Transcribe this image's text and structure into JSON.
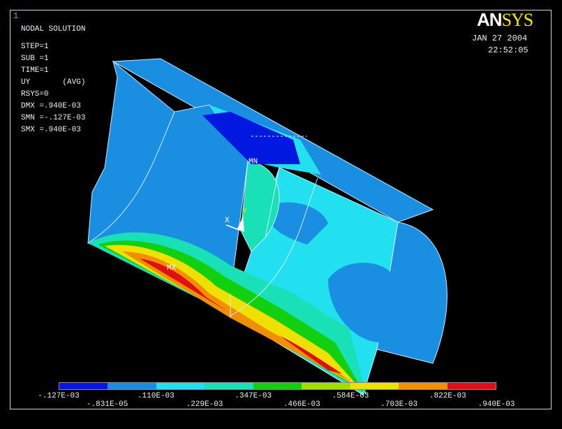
{
  "window_number": "1",
  "info": {
    "title": "NODAL SOLUTION",
    "step": "STEP=1",
    "sub": "SUB =1",
    "time": "TIME=1",
    "item": "UY       (AVG)",
    "rsys": "RSYS=0",
    "dmx": "DMX =.940E-03",
    "smn": "SMN =-.127E-03",
    "smx": "SMX =.940E-03"
  },
  "logo": {
    "an": "AN",
    "sys": "SYS"
  },
  "date": "JAN 27 2004",
  "clock": "22:52:05",
  "markers": {
    "mn": "MN",
    "mx": "MX"
  },
  "triad": {
    "x": "X",
    "y": "Y"
  },
  "legend": {
    "colors": [
      "#0018e0",
      "#1a8ee0",
      "#22e0f0",
      "#1ae0b8",
      "#10d010",
      "#a0e000",
      "#f0e000",
      "#f09000",
      "#e01010"
    ],
    "labels_bottom_row": [
      "-.127E-03",
      ".110E-03",
      ".347E-03",
      ".584E-03",
      ".822E-03"
    ],
    "labels_top_row": [
      "-.831E-05",
      ".229E-03",
      ".466E-03",
      ".703E-03",
      ".940E-03"
    ]
  }
}
